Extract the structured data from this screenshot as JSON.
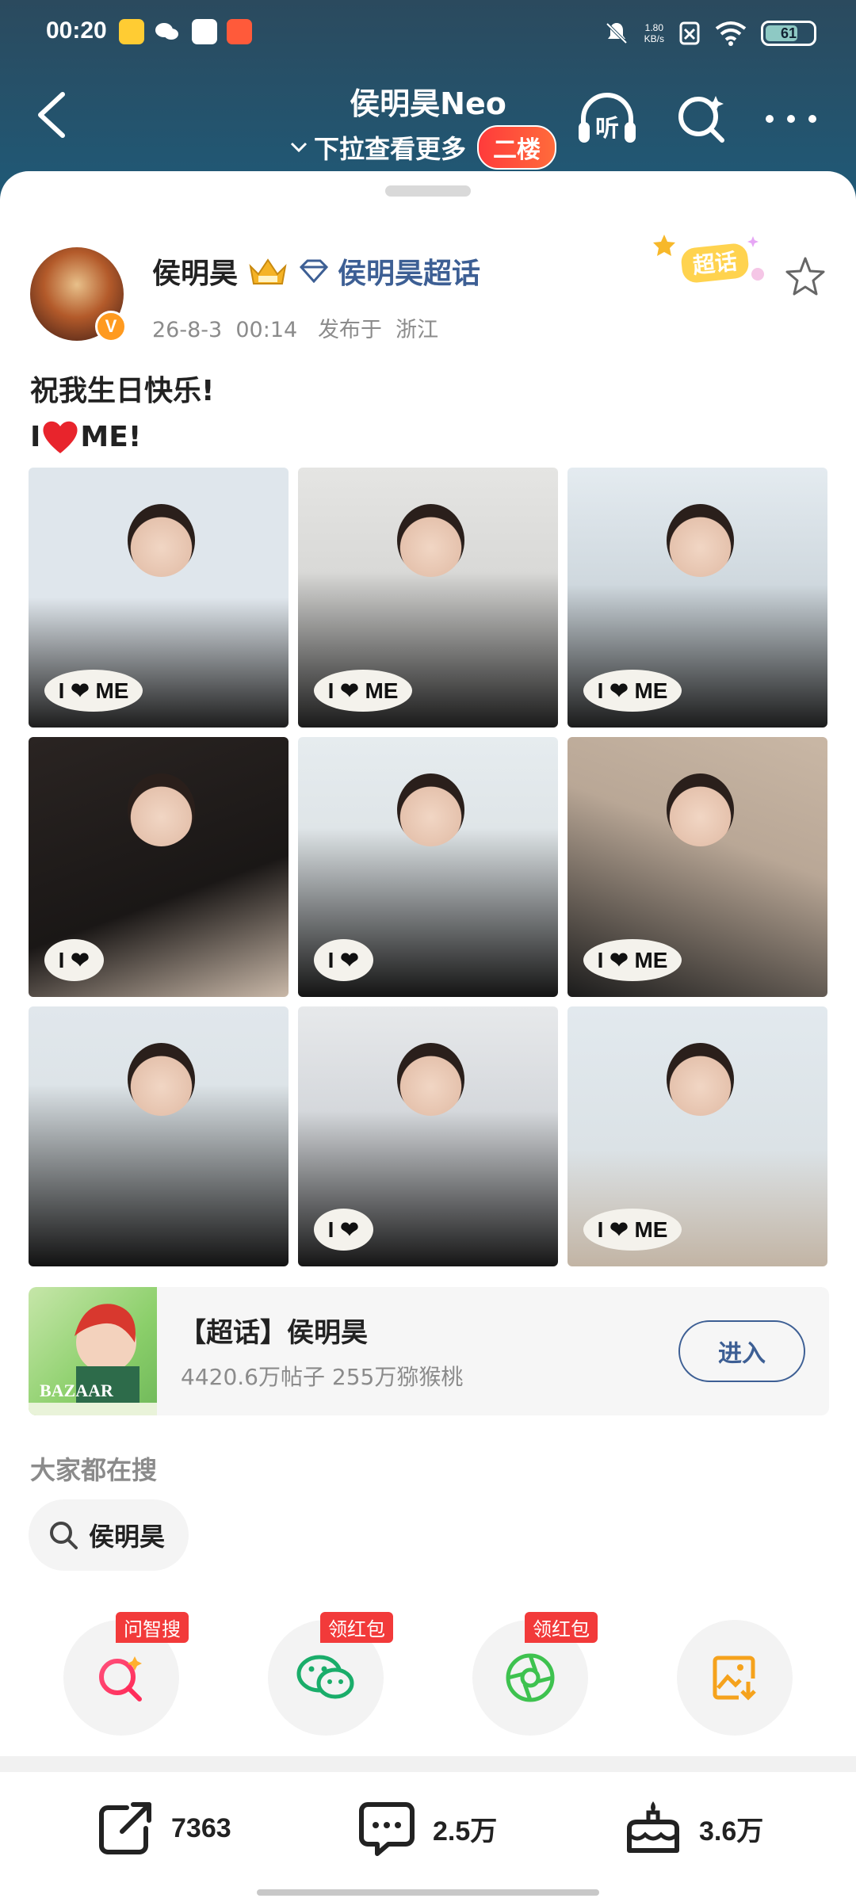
{
  "status_bar": {
    "time": "00:20",
    "speed_value": "1.80",
    "speed_unit": "KB/s",
    "battery": "61"
  },
  "nav": {
    "title": "侯明昊Neo",
    "subtitle": "下拉查看更多",
    "badge": "二楼",
    "listen_label": "听"
  },
  "post": {
    "author": "侯明昊",
    "topic": "侯明昊超话",
    "date": "26-8-3",
    "time": "00:14",
    "posted_from_label": "发布于",
    "location": "浙江",
    "badge": "超话",
    "line1": "祝我生日快乐!",
    "line2_prefix": "I",
    "line2_suffix": "ME!"
  },
  "photos": [
    {
      "label": "I ❤ ME"
    },
    {
      "label": "I ❤ ME"
    },
    {
      "label": "I ❤ ME"
    },
    {
      "label": "I ❤"
    },
    {
      "label": "I ❤"
    },
    {
      "label": "I ❤ ME"
    },
    {
      "label": ""
    },
    {
      "label": "I ❤"
    },
    {
      "label": "I ❤ ME"
    }
  ],
  "topic_card": {
    "name": "【超话】侯明昊",
    "stats": "4420.6万帖子  255万猕猴桃",
    "enter": "进入"
  },
  "search": {
    "title": "大家都在搜",
    "chip": "侯明昊"
  },
  "share": {
    "items": [
      {
        "tag": "问智搜",
        "icon": "ai-search-icon"
      },
      {
        "tag": "领红包",
        "icon": "wechat-icon"
      },
      {
        "tag": "领红包",
        "icon": "moments-icon"
      },
      {
        "tag": "",
        "icon": "save-image-icon"
      }
    ]
  },
  "actions": {
    "repost": "7363",
    "comment": "2.5万",
    "like": "3.6万"
  },
  "colors": {
    "header": "#1f5a78",
    "accent": "#3d5f94",
    "red": "#f23a3a"
  }
}
